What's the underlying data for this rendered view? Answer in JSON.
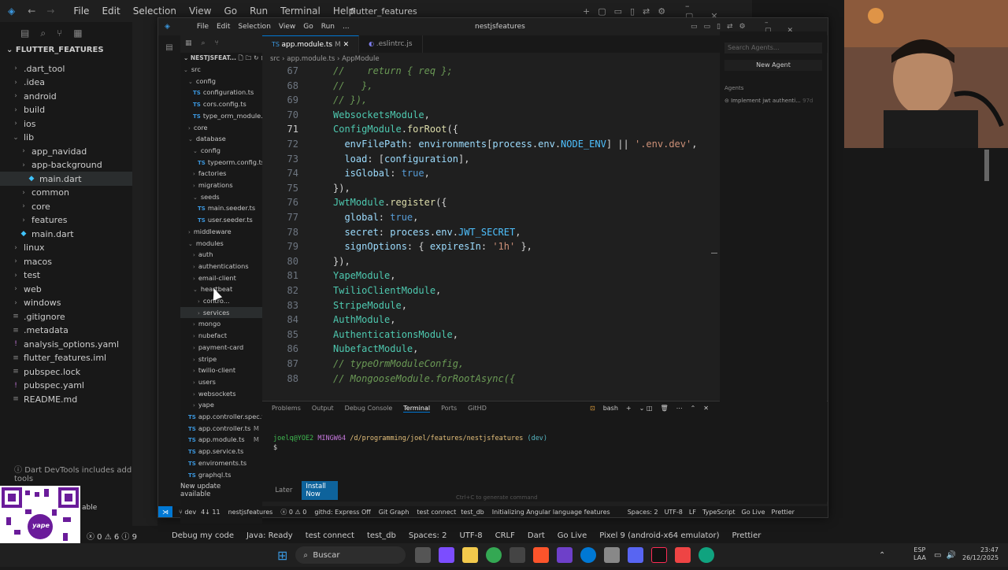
{
  "back_window": {
    "title": "flutter_features",
    "menu": [
      "File",
      "Edit",
      "Selection",
      "View",
      "Go",
      "Run",
      "Terminal",
      "Help"
    ],
    "explorer_root": "FLUTTER_FEATURES",
    "tree": [
      {
        "label": ".dart_tool",
        "indent": 1,
        "folder": true
      },
      {
        "label": ".idea",
        "indent": 1,
        "folder": true
      },
      {
        "label": "android",
        "indent": 1,
        "folder": true
      },
      {
        "label": "build",
        "indent": 1,
        "folder": true
      },
      {
        "label": "ios",
        "indent": 1,
        "folder": true
      },
      {
        "label": "lib",
        "indent": 1,
        "folder": true,
        "open": true
      },
      {
        "label": "app_navidad",
        "indent": 2,
        "folder": true
      },
      {
        "label": "app-background",
        "indent": 2,
        "folder": true
      },
      {
        "label": "main.dart",
        "indent": 3,
        "folder": false,
        "selected": true
      },
      {
        "label": "common",
        "indent": 2,
        "folder": true
      },
      {
        "label": "core",
        "indent": 2,
        "folder": true
      },
      {
        "label": "features",
        "indent": 2,
        "folder": true
      },
      {
        "label": "main.dart",
        "indent": 2,
        "folder": false
      },
      {
        "label": "linux",
        "indent": 1,
        "folder": true
      },
      {
        "label": "macos",
        "indent": 1,
        "folder": true
      },
      {
        "label": "test",
        "indent": 1,
        "folder": true
      },
      {
        "label": "web",
        "indent": 1,
        "folder": true
      },
      {
        "label": "windows",
        "indent": 1,
        "folder": true
      },
      {
        "label": ".gitignore",
        "indent": 1,
        "folder": false
      },
      {
        "label": ".metadata",
        "indent": 1,
        "folder": false
      },
      {
        "label": "analysis_options.yaml",
        "indent": 1,
        "folder": false
      },
      {
        "label": "flutter_features.iml",
        "indent": 1,
        "folder": false
      },
      {
        "label": "pubspec.lock",
        "indent": 1,
        "folder": false
      },
      {
        "label": "pubspec.yaml",
        "indent": 1,
        "folder": false
      },
      {
        "label": "README.md",
        "indent": 1,
        "folder": false
      }
    ],
    "devtools_note": "Dart DevTools includes additional tools",
    "status_items": [
      "Debug my code",
      "Java: Ready",
      "test connect",
      "test_db",
      "Spaces: 2",
      "UTF-8",
      "CRLF",
      "Dart",
      "Go Live",
      "Pixel 9 (android-x64 emulator)",
      "Prettier"
    ]
  },
  "front_window": {
    "title": "nestjsfeatures",
    "menu": [
      "File",
      "Edit",
      "Selection",
      "View",
      "Go",
      "Run",
      "..."
    ],
    "explorer_root": "NESTJSFEAT...",
    "tabs": [
      {
        "label": "app.module.ts",
        "mod": "M",
        "active": true
      },
      {
        "label": ".eslintrc.js",
        "active": false
      }
    ],
    "breadcrumb": [
      "src",
      "app.module.ts",
      "AppModule"
    ],
    "explorer": [
      {
        "label": "src",
        "indent": 0,
        "folder": true,
        "open": true
      },
      {
        "label": "config",
        "indent": 1,
        "folder": true,
        "open": true
      },
      {
        "label": "configuration.ts",
        "indent": 2,
        "folder": false
      },
      {
        "label": "cors.config.ts",
        "indent": 2,
        "folder": false
      },
      {
        "label": "type_orm_module.confi...",
        "indent": 2,
        "folder": false
      },
      {
        "label": "core",
        "indent": 1,
        "folder": true
      },
      {
        "label": "database",
        "indent": 1,
        "folder": true,
        "open": true
      },
      {
        "label": "config",
        "indent": 2,
        "folder": true,
        "open": true
      },
      {
        "label": "typeorm.config.ts",
        "indent": 3,
        "folder": false
      },
      {
        "label": "factories",
        "indent": 2,
        "folder": true
      },
      {
        "label": "migrations",
        "indent": 2,
        "folder": true
      },
      {
        "label": "seeds",
        "indent": 2,
        "folder": true,
        "open": true
      },
      {
        "label": "main.seeder.ts",
        "indent": 3,
        "folder": false
      },
      {
        "label": "user.seeder.ts",
        "indent": 3,
        "folder": false
      },
      {
        "label": "middleware",
        "indent": 1,
        "folder": true
      },
      {
        "label": "modules",
        "indent": 1,
        "folder": true,
        "open": true
      },
      {
        "label": "auth",
        "indent": 2,
        "folder": true
      },
      {
        "label": "authentications",
        "indent": 2,
        "folder": true
      },
      {
        "label": "email-client",
        "indent": 2,
        "folder": true
      },
      {
        "label": "heartbeat",
        "indent": 2,
        "folder": true,
        "open": true
      },
      {
        "label": "contro...",
        "indent": 3,
        "folder": true
      },
      {
        "label": "services",
        "indent": 3,
        "folder": true,
        "selected": true
      },
      {
        "label": "mongo",
        "indent": 2,
        "folder": true
      },
      {
        "label": "nubefact",
        "indent": 2,
        "folder": true
      },
      {
        "label": "payment-card",
        "indent": 2,
        "folder": true
      },
      {
        "label": "stripe",
        "indent": 2,
        "folder": true
      },
      {
        "label": "twilio-client",
        "indent": 2,
        "folder": true
      },
      {
        "label": "users",
        "indent": 2,
        "folder": true
      },
      {
        "label": "websockets",
        "indent": 2,
        "folder": true
      },
      {
        "label": "yape",
        "indent": 2,
        "folder": true
      },
      {
        "label": "app.controller.spec.ts",
        "indent": 1,
        "folder": false
      },
      {
        "label": "app.controller.ts",
        "indent": 1,
        "folder": false,
        "mod": "M"
      },
      {
        "label": "app.module.ts",
        "indent": 1,
        "folder": false,
        "mod": "M"
      },
      {
        "label": "app.service.ts",
        "indent": 1,
        "folder": false
      },
      {
        "label": "enviroments.ts",
        "indent": 1,
        "folder": false
      },
      {
        "label": "graphql.ts",
        "indent": 1,
        "folder": false
      }
    ],
    "code_lines": [
      {
        "n": "67",
        "tokens": [
          [
            "cm",
            "//    return { req };"
          ]
        ]
      },
      {
        "n": "68",
        "tokens": [
          [
            "cm",
            "//   },"
          ]
        ]
      },
      {
        "n": "69",
        "tokens": [
          [
            "cm",
            "// }),"
          ]
        ]
      },
      {
        "n": "70",
        "tokens": [
          [
            "cls",
            "WebsocketsModule"
          ],
          [
            "pun",
            ","
          ]
        ]
      },
      {
        "n": "71",
        "tokens": [
          [
            "cls",
            "ConfigModule"
          ],
          [
            "pun",
            "."
          ],
          [
            "fn",
            "forRoot"
          ],
          [
            "pun",
            "({"
          ]
        ]
      },
      {
        "n": "72",
        "tokens": [
          [
            "prop",
            "  envFilePath"
          ],
          [
            "pun",
            ": "
          ],
          [
            "prop",
            "environments"
          ],
          [
            "pun",
            "["
          ],
          [
            "prop",
            "process"
          ],
          [
            "pun",
            "."
          ],
          [
            "prop",
            "env"
          ],
          [
            "pun",
            "."
          ],
          [
            "env",
            "NODE_ENV"
          ],
          [
            "pun",
            "] || "
          ],
          [
            "str",
            "'.env.dev'"
          ],
          [
            "pun",
            ","
          ]
        ]
      },
      {
        "n": "73",
        "tokens": [
          [
            "prop",
            "  load"
          ],
          [
            "pun",
            ": ["
          ],
          [
            "prop",
            "configuration"
          ],
          [
            "pun",
            "],"
          ]
        ]
      },
      {
        "n": "74",
        "tokens": [
          [
            "prop",
            "  isGlobal"
          ],
          [
            "pun",
            ": "
          ],
          [
            "kw",
            "true"
          ],
          [
            "pun",
            ","
          ]
        ]
      },
      {
        "n": "75",
        "tokens": [
          [
            "pun",
            "}),"
          ]
        ]
      },
      {
        "n": "76",
        "tokens": [
          [
            "cls",
            "JwtModule"
          ],
          [
            "pun",
            "."
          ],
          [
            "fn",
            "register"
          ],
          [
            "pun",
            "({"
          ]
        ]
      },
      {
        "n": "77",
        "tokens": [
          [
            "prop",
            "  global"
          ],
          [
            "pun",
            ": "
          ],
          [
            "kw",
            "true"
          ],
          [
            "pun",
            ","
          ]
        ]
      },
      {
        "n": "78",
        "tokens": [
          [
            "prop",
            "  secret"
          ],
          [
            "pun",
            ": "
          ],
          [
            "prop",
            "process"
          ],
          [
            "pun",
            "."
          ],
          [
            "prop",
            "env"
          ],
          [
            "pun",
            "."
          ],
          [
            "env",
            "JWT_SECRET"
          ],
          [
            "pun",
            ","
          ]
        ]
      },
      {
        "n": "79",
        "tokens": [
          [
            "prop",
            "  signOptions"
          ],
          [
            "pun",
            ": { "
          ],
          [
            "prop",
            "expiresIn"
          ],
          [
            "pun",
            ": "
          ],
          [
            "str",
            "'1h'"
          ],
          [
            "pun",
            " },"
          ]
        ]
      },
      {
        "n": "80",
        "tokens": [
          [
            "pun",
            "}),"
          ]
        ]
      },
      {
        "n": "81",
        "tokens": [
          [
            "cls",
            "YapeModule"
          ],
          [
            "pun",
            ","
          ]
        ]
      },
      {
        "n": "82",
        "tokens": [
          [
            "cls",
            "TwilioClientModule"
          ],
          [
            "pun",
            ","
          ]
        ]
      },
      {
        "n": "83",
        "tokens": [
          [
            "cls",
            "StripeModule"
          ],
          [
            "pun",
            ","
          ]
        ]
      },
      {
        "n": "84",
        "tokens": [
          [
            "cls",
            "AuthModule"
          ],
          [
            "pun",
            ","
          ]
        ]
      },
      {
        "n": "85",
        "tokens": [
          [
            "cls",
            "AuthenticationsModule"
          ],
          [
            "pun",
            ","
          ]
        ]
      },
      {
        "n": "86",
        "tokens": [
          [
            "cls",
            "NubefactModule"
          ],
          [
            "pun",
            ","
          ]
        ]
      },
      {
        "n": "87",
        "tokens": [
          [
            "cm",
            "// typeOrmModuleConfig,"
          ]
        ]
      },
      {
        "n": "88",
        "tokens": [
          [
            "cm",
            "// MongooseModule.forRootAsync({"
          ]
        ]
      }
    ],
    "panel_tabs": [
      "Problems",
      "Output",
      "Debug Console",
      "Terminal",
      "Ports",
      "GitHD"
    ],
    "panel_active": "Terminal",
    "terminal_shell": "bash",
    "terminal_prompt_user": "joelq@YOE2",
    "terminal_prompt_mingw": "MINGW64",
    "terminal_prompt_path": "/d/programming/joel/features/nestjsfeatures",
    "terminal_prompt_branch": "(dev)",
    "terminal_cursor": "$",
    "terminal_hint": "Ctrl+C to generate command",
    "update_text": "New update available",
    "update_later": "Later",
    "update_install": "Install Now",
    "status": {
      "branch": "dev",
      "sync": "4↓ 11",
      "project": "nestjsfeatures",
      "errors": "0",
      "warnings": "0",
      "githd": "githd: Express Off",
      "git_graph": "Git Graph",
      "test_connect": "test connect",
      "test_db": "test_db",
      "angular": "Initializing Angular language features",
      "spaces": "Spaces: 2",
      "encoding": "UTF-8",
      "eol": "LF",
      "lang": "TypeScript",
      "golive": "Go Live",
      "prettier": "Prettier"
    }
  },
  "agent_panel": {
    "search_placeholder": "Search Agents...",
    "new_agent": "New Agent",
    "section": "Agents",
    "item": "Implement jwt authenti...",
    "item_time": "97d"
  },
  "taskbar": {
    "search": "Buscar",
    "lang": "ESP",
    "lang2": "LAA",
    "time": "23:47",
    "date": "26/12/2025"
  },
  "colors": {
    "accent": "#0078d4",
    "install": "#0e639c"
  }
}
